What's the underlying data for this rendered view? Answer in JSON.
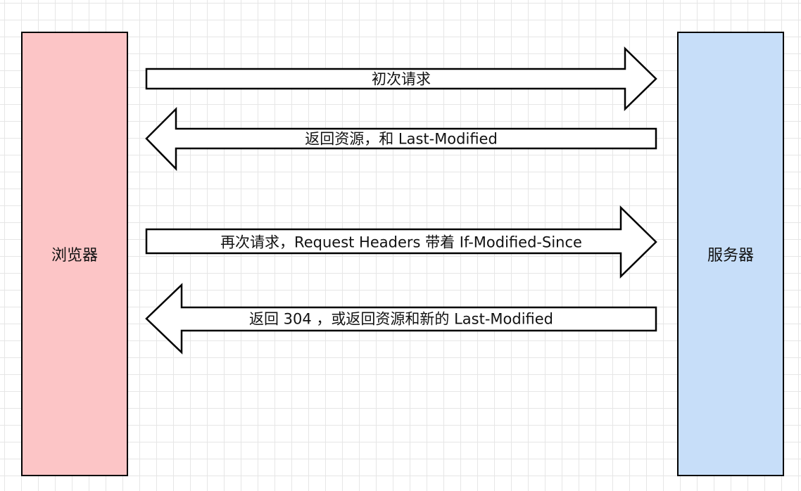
{
  "actors": {
    "browser": {
      "label": "浏览器",
      "color": "#fcc5c6"
    },
    "server": {
      "label": "服务器",
      "color": "#c7def9"
    }
  },
  "messages": [
    {
      "label": "初次请求",
      "direction": "right"
    },
    {
      "label": "返回资源，和 Last-Modified",
      "direction": "left"
    },
    {
      "label": "再次请求，Request Headers 带着 If-Modified-Since",
      "direction": "right"
    },
    {
      "label": "返回 304 ，或返回资源和新的 Last-Modified",
      "direction": "left"
    }
  ]
}
